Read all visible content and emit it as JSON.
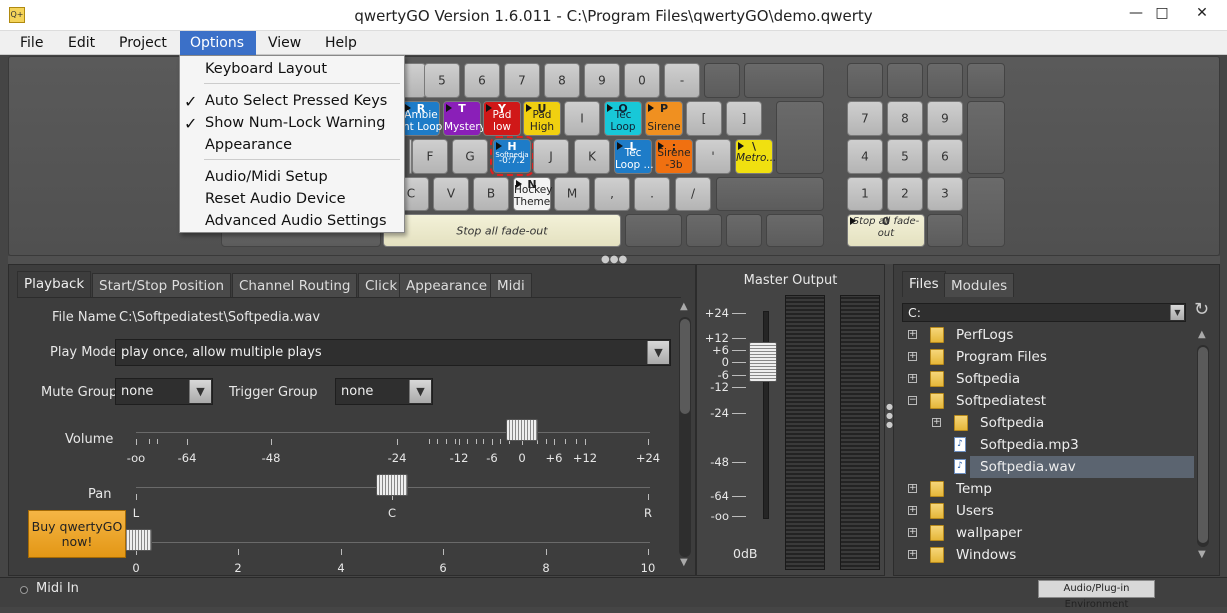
{
  "window": {
    "title": "qwertyGO Version 1.6.011 - C:\\Program Files\\qwertyGO\\demo.qwerty",
    "icon_text": "Q+",
    "min": "—",
    "max": "□",
    "close": "✕"
  },
  "menu": [
    "File",
    "Edit",
    "Project",
    "Options",
    "View",
    "Help"
  ],
  "options_menu": {
    "items": [
      "Keyboard Layout",
      "Auto Select Pressed Keys",
      "Show Num-Lock Warning",
      "Appearance",
      "Audio/Midi Setup",
      "Reset Audio Device",
      "Advanced Audio Settings"
    ],
    "checked": [
      "✓",
      "✓"
    ]
  },
  "keys": {
    "row1": [
      "5",
      "6",
      "7",
      "8",
      "9",
      "0",
      "-"
    ],
    "r_key": {
      "top": "R",
      "bot": "Ambie\nnt Loop",
      "color": "#1e7cc8"
    },
    "t_key": {
      "top": "T",
      "bot": "Mystery",
      "color": "#8a1fb8"
    },
    "y_key": {
      "top": "Y",
      "bot": "Pad low",
      "color": "#d01818"
    },
    "u_key": {
      "top": "U",
      "bot": "Pad\nHigh",
      "color": "#f0d010"
    },
    "i_key": "I",
    "o_key": {
      "top": "O",
      "bot": "Tec\nLoop",
      "color": "#18c8d8"
    },
    "p_key": {
      "top": "P",
      "bot": "Sirene",
      "color": "#f09020"
    },
    "lbracket": "[",
    "rbracket": "]",
    "f_key": "F",
    "g_key": "G",
    "h_key": {
      "top": "H",
      "mid": "Softpedia",
      "bot": "-0:7.2",
      "color": "#1e7cc8"
    },
    "j_key": "J",
    "k_key": "K",
    "l_key": {
      "top": "L",
      "bot": "Tec\nLoop ...",
      "color": "#1e7cc8"
    },
    "semi_key": {
      "top": ";",
      "bot": "Sirene\n-3b",
      "color": "#f07010"
    },
    "quote_key": "'",
    "bslash_key": {
      "top": "\\",
      "bot": "Metro...",
      "color": "#f0e010"
    },
    "c_key": "C",
    "v_key": "V",
    "b_key": "B",
    "n_key": {
      "top": "N",
      "bot": "Hockey\nTheme",
      "color": "#f0f0f0"
    },
    "m_key": "M",
    "comma_key": ",",
    "period_key": ".",
    "slash_key": "/",
    "space": "Stop all fade-out",
    "num": [
      "7",
      "8",
      "9",
      "4",
      "5",
      "6",
      "1",
      "2",
      "3"
    ],
    "num0": {
      "top": "0",
      "bot": "Stop all fade-out"
    }
  },
  "tabs": [
    "Playback",
    "Start/Stop Position",
    "Channel Routing",
    "Click",
    "Appearance",
    "Midi"
  ],
  "playback": {
    "file_name_label": "File Name",
    "file_name": "C:\\Softpediatest\\Softpedia.wav",
    "play_mode_label": "Play Mode",
    "play_mode": "play once, allow multiple plays",
    "mute_group_label": "Mute Group",
    "mute_group": "none",
    "trigger_group_label": "Trigger Group",
    "trigger_group": "none",
    "volume_label": "Volume",
    "volume_ticks": [
      "-oo",
      "-64",
      "-48",
      "-24",
      "-12",
      "-6",
      "0",
      "+6",
      "+12",
      "+24"
    ],
    "volume_value_db": 0,
    "pan_label": "Pan",
    "pan_ticks": [
      "L",
      "C",
      "R"
    ],
    "pan_value": "C",
    "third_ticks": [
      "0",
      "2",
      "4",
      "6",
      "8",
      "10"
    ],
    "third_value": 0,
    "buy": "Buy qwertyGO now!"
  },
  "master": {
    "title": "Master Output",
    "scale": [
      "+24",
      "+12",
      "+6",
      "0",
      "-6",
      "-12",
      "-24",
      "-48",
      "-64",
      "-oo"
    ],
    "readout": "0dB"
  },
  "files": {
    "tabs": [
      "Files",
      "Modules"
    ],
    "drive": "C:",
    "tree": [
      {
        "name": "PerfLogs",
        "type": "folder",
        "level": 0,
        "exp": "+"
      },
      {
        "name": "Program Files",
        "type": "folder",
        "level": 0,
        "exp": "+"
      },
      {
        "name": "Softpedia",
        "type": "folder",
        "level": 0,
        "exp": "+"
      },
      {
        "name": "Softpediatest",
        "type": "folder",
        "level": 0,
        "exp": "−"
      },
      {
        "name": "Softpedia",
        "type": "folder",
        "level": 1,
        "exp": "+"
      },
      {
        "name": "Softpedia.mp3",
        "type": "file",
        "level": 1,
        "exp": ""
      },
      {
        "name": "Softpedia.wav",
        "type": "file",
        "level": 1,
        "exp": "",
        "selected": true
      },
      {
        "name": "Temp",
        "type": "folder",
        "level": 0,
        "exp": "+"
      },
      {
        "name": "Users",
        "type": "folder",
        "level": 0,
        "exp": "+"
      },
      {
        "name": "wallpaper",
        "type": "folder",
        "level": 0,
        "exp": "+"
      },
      {
        "name": "Windows",
        "type": "folder",
        "level": 0,
        "exp": "+"
      }
    ]
  },
  "status": {
    "midi_in": "Midi In",
    "audio_plugin": "Audio/Plug-in Environment"
  }
}
